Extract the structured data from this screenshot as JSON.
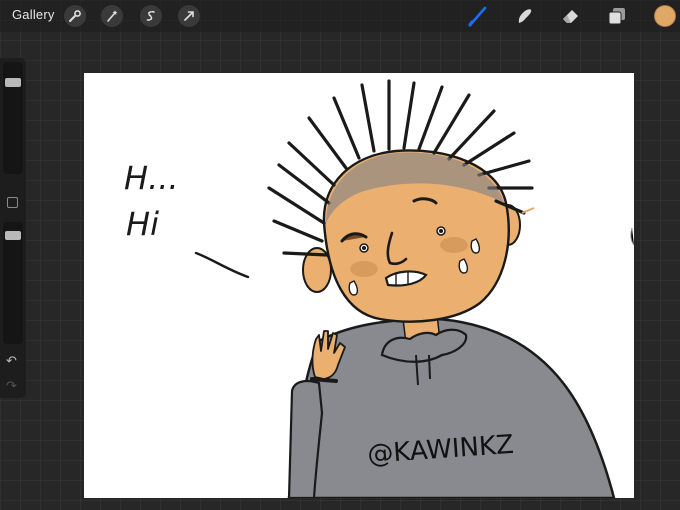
{
  "toolbar": {
    "gallery_label": "Gallery",
    "left_tools": [
      "wrench-icon",
      "magic-wand-icon",
      "selection-icon",
      "transform-arrow-icon"
    ],
    "right_tools": [
      "brush-icon",
      "smudge-icon",
      "eraser-icon",
      "layers-icon"
    ],
    "active_tool": "brush",
    "active_tool_color": "#1f6bff",
    "current_color": "#e0a866"
  },
  "sidebar": {
    "brush_size": 0.15,
    "opacity": 0.05,
    "undo_icon": "undo-arrow-icon",
    "redo_icon": "redo-arrow-icon"
  },
  "artwork": {
    "handwritten_text_line1": "H...",
    "handwritten_text_line2": "Hi",
    "signature": "@KAWINKZ",
    "skin_color": "#ebb06f",
    "hoodie_color": "#888a90",
    "hair_color": "#1a1a1a"
  }
}
